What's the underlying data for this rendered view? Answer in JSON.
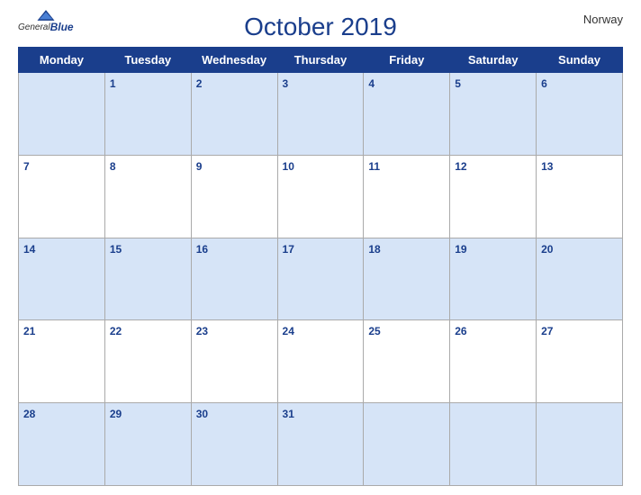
{
  "header": {
    "month_year": "October 2019",
    "country": "Norway",
    "logo_general": "General",
    "logo_blue": "Blue"
  },
  "days_of_week": [
    "Monday",
    "Tuesday",
    "Wednesday",
    "Thursday",
    "Friday",
    "Saturday",
    "Sunday"
  ],
  "weeks": [
    [
      "",
      "1",
      "2",
      "3",
      "4",
      "5",
      "6"
    ],
    [
      "7",
      "8",
      "9",
      "10",
      "11",
      "12",
      "13"
    ],
    [
      "14",
      "15",
      "16",
      "17",
      "18",
      "19",
      "20"
    ],
    [
      "21",
      "22",
      "23",
      "24",
      "25",
      "26",
      "27"
    ],
    [
      "28",
      "29",
      "30",
      "31",
      "",
      "",
      ""
    ]
  ]
}
